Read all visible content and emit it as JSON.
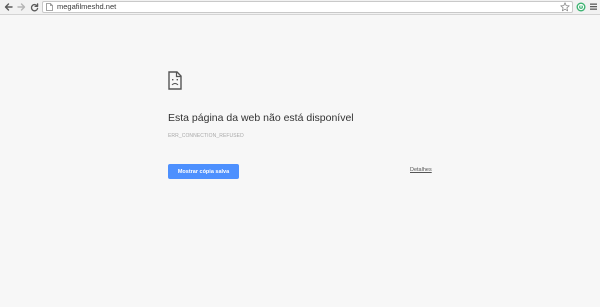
{
  "toolbar": {
    "back_icon": "back-arrow-icon",
    "forward_icon": "forward-arrow-icon",
    "reload_icon": "reload-icon",
    "url": "megafilmeshd.net",
    "star_icon": "star-icon",
    "extension_icon": "extension-icon",
    "menu_icon": "hamburger-menu-icon",
    "extension_color": "#3cb371"
  },
  "error_page": {
    "icon": "sad-page-icon",
    "title": "Esta página da web não está disponível",
    "code": "ERR_CONNECTION_REFUSED",
    "button_label": "Mostrar cópia salva",
    "details_label": "Detalhes",
    "button_color": "#4d90fe"
  }
}
